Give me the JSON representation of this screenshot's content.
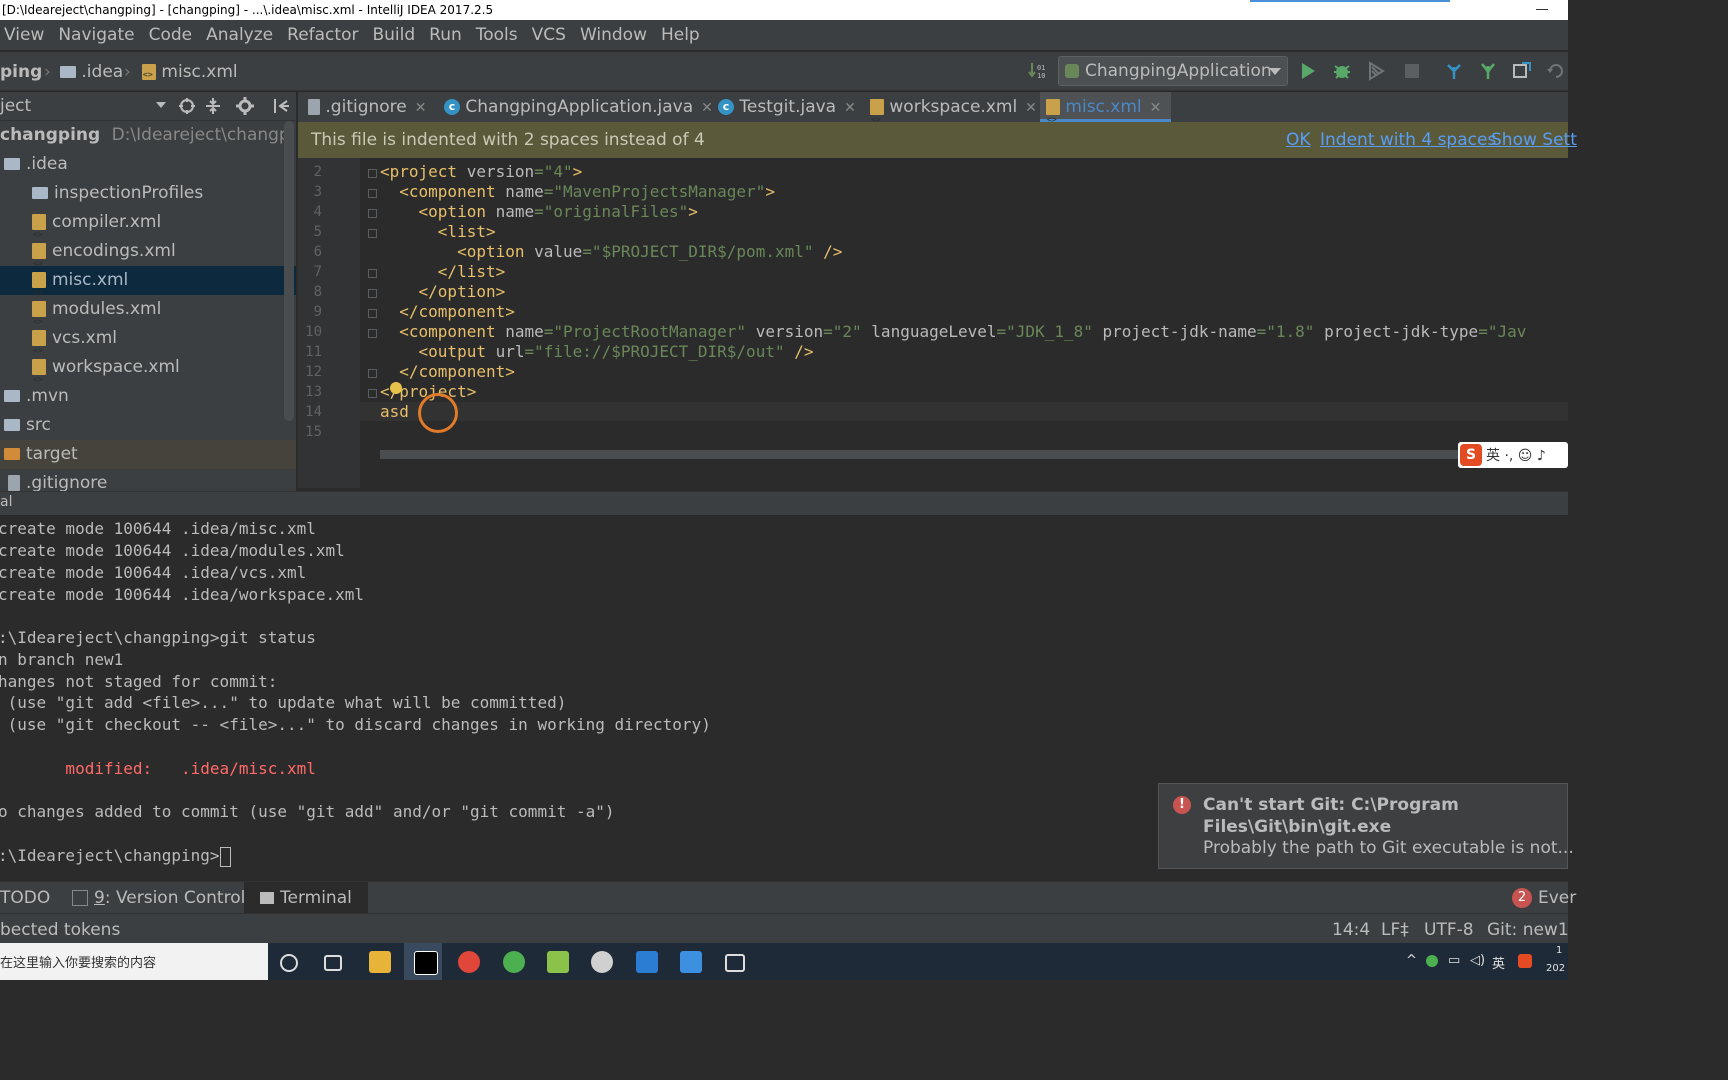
{
  "window": {
    "title": "[D:\\Ideareject\\changping] - [changping] - ...\\.idea\\misc.xml - IntelliJ IDEA 2017.2.5"
  },
  "menu": [
    "View",
    "Navigate",
    "Code",
    "Analyze",
    "Refactor",
    "Build",
    "Run",
    "Tools",
    "VCS",
    "Window",
    "Help"
  ],
  "breadcrumb": {
    "project": "ping",
    "folder": ".idea",
    "file": "misc.xml"
  },
  "run_config": {
    "label": "ChangpingApplication"
  },
  "project_panel": {
    "header": "ject",
    "root": {
      "name": "changping",
      "path": "D:\\Ideareject\\changping"
    },
    "items": [
      {
        "label": ".idea",
        "kind": "folder"
      },
      {
        "label": "inspectionProfiles",
        "kind": "folder"
      },
      {
        "label": "compiler.xml",
        "kind": "xml"
      },
      {
        "label": "encodings.xml",
        "kind": "xml"
      },
      {
        "label": "misc.xml",
        "kind": "xml"
      },
      {
        "label": "modules.xml",
        "kind": "xml"
      },
      {
        "label": "vcs.xml",
        "kind": "xml"
      },
      {
        "label": "workspace.xml",
        "kind": "xml"
      },
      {
        "label": ".mvn",
        "kind": "folder"
      },
      {
        "label": "src",
        "kind": "folder"
      },
      {
        "label": "target",
        "kind": "folder-orange"
      },
      {
        "label": ".gitignore",
        "kind": "file"
      }
    ]
  },
  "tabs": [
    {
      "label": ".gitignore",
      "kind": "file"
    },
    {
      "label": "ChangpingApplication.java",
      "kind": "java"
    },
    {
      "label": "Testgit.java",
      "kind": "java"
    },
    {
      "label": "workspace.xml",
      "kind": "xml"
    },
    {
      "label": "misc.xml",
      "kind": "xml",
      "active": true
    }
  ],
  "banner": {
    "message": "This file is indented with 2 spaces instead of 4",
    "ok": "OK",
    "indent": "Indent with 4 spaces",
    "show": "Show Sett"
  },
  "editor": {
    "line_numbers": [
      "2",
      "3",
      "4",
      "5",
      "6",
      "7",
      "8",
      "9",
      "10",
      "11",
      "12",
      "13",
      "14",
      "15"
    ],
    "lines": {
      "l2a": "<project ",
      "l2b": "version",
      "l2c": "=\"4\"",
      "l2d": ">",
      "l3a": "  <component ",
      "l3b": "name",
      "l3c": "=\"MavenProjectsManager\"",
      "l3d": ">",
      "l4a": "    <option ",
      "l4b": "name",
      "l4c": "=\"originalFiles\"",
      "l4d": ">",
      "l5": "      <list>",
      "l6a": "        <option ",
      "l6b": "value",
      "l6c": "=\"$PROJECT_DIR$/pom.xml\"",
      "l6d": " />",
      "l7": "      </list>",
      "l8": "    </option>",
      "l9": "  </component>",
      "l10a": "  <component ",
      "l10b": "name",
      "l10c": "=\"ProjectRootManager\" ",
      "l10d": "version",
      "l10e": "=\"2\" ",
      "l10f": "languageLevel",
      "l10g": "=\"JDK_1_8\" ",
      "l10h": "project-jdk-name",
      "l10i": "=\"1.8\" ",
      "l10j": "project-jdk-type",
      "l10k": "=\"Jav",
      "l11a": "    <output ",
      "l11b": "url",
      "l11c": "=\"file://$PROJECT_DIR$/out\"",
      "l11d": " />",
      "l12": "  </component>",
      "l13": "</project>",
      "l14": "asd"
    }
  },
  "ime": {
    "text": "英 ·, ☺ ♪"
  },
  "terminal": {
    "header": "al",
    "lines": [
      "create mode 100644 .idea/misc.xml",
      "create mode 100644 .idea/modules.xml",
      "create mode 100644 .idea/vcs.xml",
      "create mode 100644 .idea/workspace.xml",
      "",
      ":\\Ideareject\\changping>git status",
      "n branch new1",
      "hanges not staged for commit:",
      " (use \"git add <file>...\" to update what will be committed)",
      " (use \"git checkout -- <file>...\" to discard changes in working directory)",
      "",
      "       modified:   .idea/misc.xml",
      "",
      "o changes added to commit (use \"git add\" and/or \"git commit -a\")",
      "",
      ":\\Ideareject\\changping>"
    ]
  },
  "notification": {
    "title": "Can't start Git: C:\\Program Files\\Git\\bin\\git.exe",
    "body": "Probably the path to Git executable is not..."
  },
  "tool_tabs": {
    "todo": "TODO",
    "vc_num": "9",
    "vc": ": Version Control",
    "terminal": "Terminal",
    "events_count": "2",
    "events": "Ever"
  },
  "status": {
    "message": "bected tokens",
    "position": "14:4",
    "line_sep": "LF",
    "encoding": "UTF-8",
    "git": "Git: new1"
  },
  "taskbar": {
    "search": "在这里输入你要搜索的内容",
    "tray_lang": "英",
    "tray_time": "1",
    "tray_date": "202"
  },
  "colors": {
    "accent": "#4a88c7",
    "error": "#c75450",
    "banner": "#5a5a3a"
  }
}
